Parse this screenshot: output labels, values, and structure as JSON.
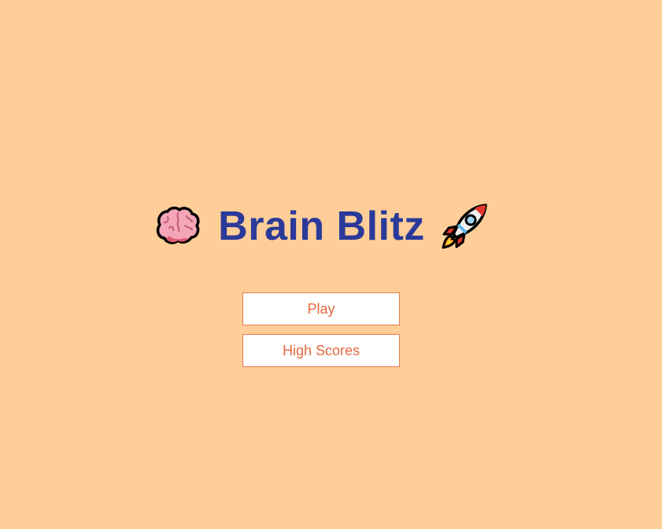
{
  "game": {
    "title": "Brain Blitz",
    "title_icons": [
      "brain-icon",
      "rocket-icon"
    ]
  },
  "menu": {
    "play_label": "Play",
    "high_scores_label": "High Scores"
  },
  "colors": {
    "background": "#FFCE98",
    "title": "#2B3A9A",
    "button_text": "#E5693C",
    "button_border": "#E77A4F",
    "button_background": "#FFFFFF"
  }
}
